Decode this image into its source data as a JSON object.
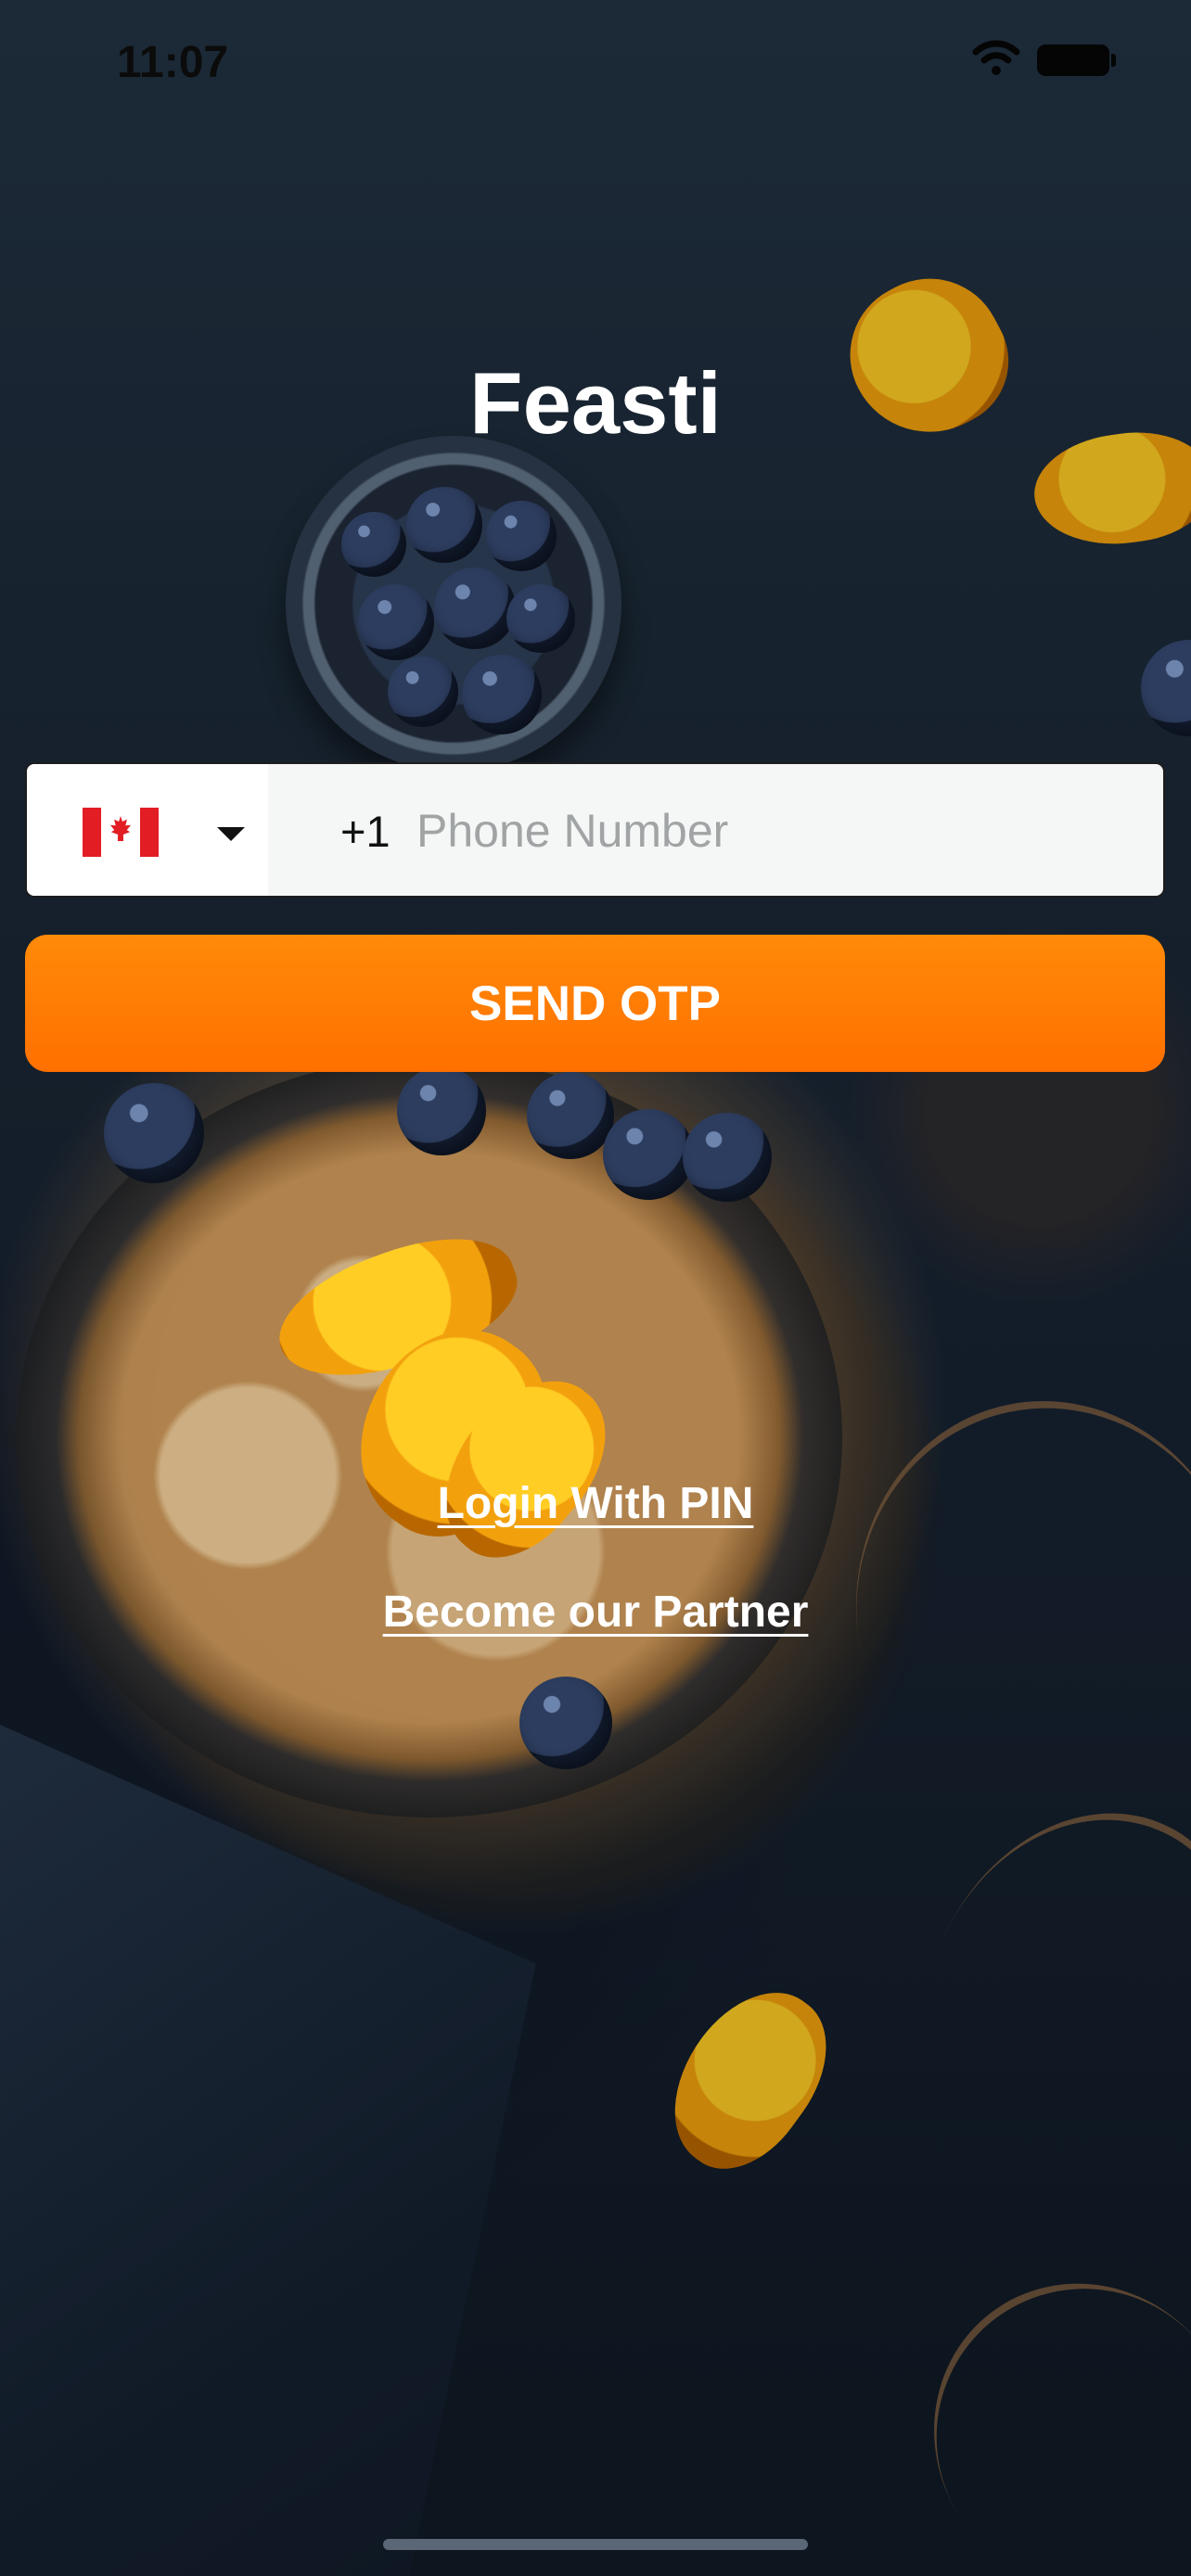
{
  "status_bar": {
    "time": "11:07"
  },
  "app": {
    "title": "Feasti"
  },
  "phone_form": {
    "country_flag": "Canada flag",
    "dial_code": "+1",
    "phone_value": "",
    "phone_placeholder": "Phone Number",
    "send_button_label": "SEND OTP"
  },
  "links": {
    "login_with_pin": "Login With PIN",
    "become_partner": "Become our Partner"
  },
  "icons": {
    "wifi": "wifi-icon",
    "battery": "battery-icon",
    "dropdown": "chevron-down-icon"
  },
  "colors": {
    "accent": "#ff7f00",
    "text_on_dark": "#ffffff",
    "input_background": "#f5f7f7"
  }
}
